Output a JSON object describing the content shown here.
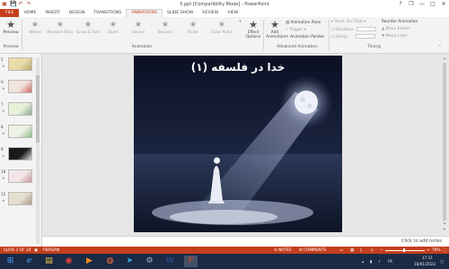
{
  "window": {
    "title": "5.ppt [Compatibility Mode] - PowerPoint",
    "controls": {
      "help": "?",
      "restore": "❐",
      "minimize": "—",
      "maximize": "□",
      "close": "✕"
    }
  },
  "quick_access": {
    "save": "💾",
    "undo": "↶",
    "redo": "↷",
    "start": "▣"
  },
  "tabs": [
    "FILE",
    "HOME",
    "INSERT",
    "DESIGN",
    "TRANSITIONS",
    "ANIMATIONS",
    "SLIDE SHOW",
    "REVIEW",
    "VIEW"
  ],
  "active_tab": "ANIMATIONS",
  "ribbon": {
    "preview": {
      "label": "Preview",
      "icon": "★"
    },
    "animations": [
      {
        "label": "Wheel",
        "icon": "✶"
      },
      {
        "label": "Random Bars",
        "icon": "✶"
      },
      {
        "label": "Grow & Turn",
        "icon": "✶"
      },
      {
        "label": "Zoom",
        "icon": "✶"
      },
      {
        "label": "Swivel",
        "icon": "✶"
      },
      {
        "label": "Bounce",
        "icon": "✶"
      },
      {
        "label": "Pulse",
        "icon": "✶"
      },
      {
        "label": "Color Pulse",
        "icon": "✶"
      }
    ],
    "effect_options": {
      "label": "Effect Options",
      "icon": "★"
    },
    "add_animation": {
      "label": "Add Animation",
      "icon": "★"
    },
    "advanced": {
      "animation_pane": "Animation Pane",
      "trigger": "Trigger",
      "animation_painter": "Animation Painter"
    },
    "timing": {
      "start_label": "Start:",
      "start_value": "On Click",
      "duration_label": "Duration:",
      "delay_label": "Delay:",
      "reorder_title": "Reorder Animation",
      "move_earlier": "Move Earlier",
      "move_later": "Move Later"
    },
    "groups": {
      "preview": "Preview",
      "animation": "Animation",
      "advanced": "Advanced Animation",
      "timing": "Timing"
    }
  },
  "thumbnails": [
    {
      "num": "5",
      "colors": [
        "#e9dca8",
        "#b7a56a"
      ]
    },
    {
      "num": "6",
      "colors": [
        "#f2e4dc",
        "#c66"
      ]
    },
    {
      "num": "7",
      "colors": [
        "#e8f0d8",
        "#8a9"
      ]
    },
    {
      "num": "8",
      "colors": [
        "#eef2e6",
        "#8b8"
      ]
    },
    {
      "num": "9",
      "colors": [
        "#1a1a1a",
        "#ddd"
      ]
    },
    {
      "num": "10",
      "colors": [
        "#f3e6e8",
        "#c99"
      ]
    },
    {
      "num": "11",
      "colors": [
        "#e6e0d0",
        "#a98"
      ]
    }
  ],
  "slide": {
    "title": "خدا در فلسفه (۱)"
  },
  "notes": {
    "placeholder": "Click to add notes"
  },
  "status": {
    "slide_info": "SLIDE 2 OF 24",
    "language": "PERSIAN",
    "notes": "NOTES",
    "comments": "COMMENTS",
    "zoom": "78%"
  },
  "taskbar": {
    "apps": [
      {
        "name": "start",
        "icon": "⊞",
        "color": "#4aa3ff"
      },
      {
        "name": "ie",
        "icon": "ℯ",
        "color": "#3fa9f5"
      },
      {
        "name": "explorer",
        "icon": "▤",
        "color": "#f2c14e"
      },
      {
        "name": "chrome",
        "icon": "◉",
        "color": "#e94235"
      },
      {
        "name": "media",
        "icon": "▶",
        "color": "#f08a1c"
      },
      {
        "name": "firefox",
        "icon": "◍",
        "color": "#ff7139"
      },
      {
        "name": "telegram",
        "icon": "➤",
        "color": "#3ba7e0"
      },
      {
        "name": "settings",
        "icon": "⚙",
        "color": "#9bc"
      },
      {
        "name": "word",
        "icon": "W",
        "color": "#2b579a"
      },
      {
        "name": "powerpoint",
        "icon": "P",
        "color": "#d24726"
      }
    ],
    "tray": {
      "lang": "FA",
      "time": "17:11",
      "date": "18/01/2022"
    }
  }
}
